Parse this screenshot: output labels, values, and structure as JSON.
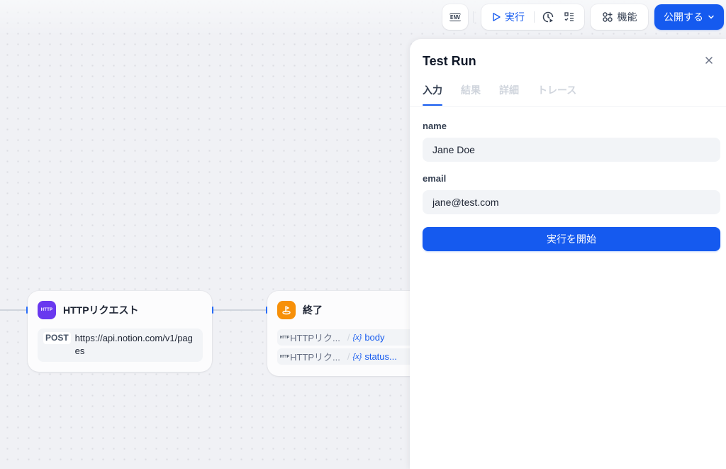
{
  "toolbar": {
    "env_label": "ENV",
    "run_label": "実行",
    "features_label": "機能",
    "publish_label": "公開する",
    "icons": {
      "env": "env-icon",
      "run": "play-icon",
      "history": "clock-play-icon",
      "checklist": "checklist-icon",
      "features": "features-grid-icon",
      "publish": "chevron-down-icon"
    }
  },
  "nodes": [
    {
      "title": "HTTPリクエスト",
      "icon": "http-icon",
      "icon_text": "HTTP",
      "method": "POST",
      "url": "https://api.notion.com/v1/pages"
    },
    {
      "title": "終了",
      "icon": "flag-icon",
      "variables": [
        {
          "tag": "HTTP",
          "node": "HTTPリク...",
          "name": "body"
        },
        {
          "tag": "HTTP",
          "node": "HTTPリク...",
          "name": "status..."
        }
      ]
    }
  ],
  "panel": {
    "title": "Test Run",
    "tabs": [
      {
        "label": "入力",
        "active": true
      },
      {
        "label": "結果",
        "active": false
      },
      {
        "label": "詳細",
        "active": false
      },
      {
        "label": "トレース",
        "active": false
      }
    ],
    "fields": [
      {
        "label": "name",
        "value": "Jane Doe"
      },
      {
        "label": "email",
        "value": "jane@test.com"
      }
    ],
    "start_button": "実行を開始"
  },
  "colors": {
    "accent": "#155aef",
    "http_node": "#6938ef",
    "end_node": "#f79009"
  }
}
